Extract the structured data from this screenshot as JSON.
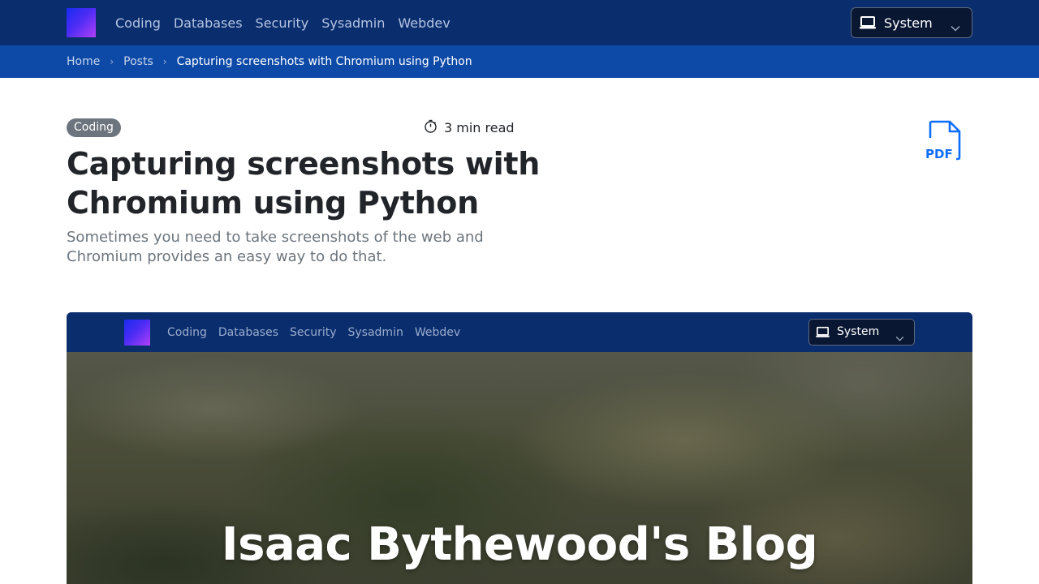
{
  "navbar": {
    "links": [
      "Coding",
      "Databases",
      "Security",
      "Sysadmin",
      "Webdev"
    ],
    "theme_label": "System"
  },
  "breadcrumb": {
    "home": "Home",
    "posts": "Posts",
    "current": "Capturing screenshots with Chromium using Python"
  },
  "post": {
    "tag": "Coding",
    "read_time": "3 min read",
    "title": "Capturing screenshots with Chromium using Python",
    "subtitle": "Sometimes you need to take screenshots of the web and Chromium provides an easy way to do that.",
    "pdf_label": "PDF"
  },
  "image": {
    "links": [
      "Coding",
      "Databases",
      "Security",
      "Sysadmin",
      "Webdev"
    ],
    "theme_label": "System",
    "hero_title": "Isaac Bythewood's Blog"
  },
  "colors": {
    "navbar": "#0a2d6e",
    "breadcrumb_bar": "#0d4aa8",
    "accent": "#0d6efd",
    "tag": "#6c757d"
  },
  "icons": {
    "theme": "laptop-icon",
    "dropdown": "chevron-down-icon",
    "read_time": "stopwatch-icon",
    "pdf": "file-pdf-icon",
    "breadcrumb_separator": "chevron-right-icon"
  }
}
